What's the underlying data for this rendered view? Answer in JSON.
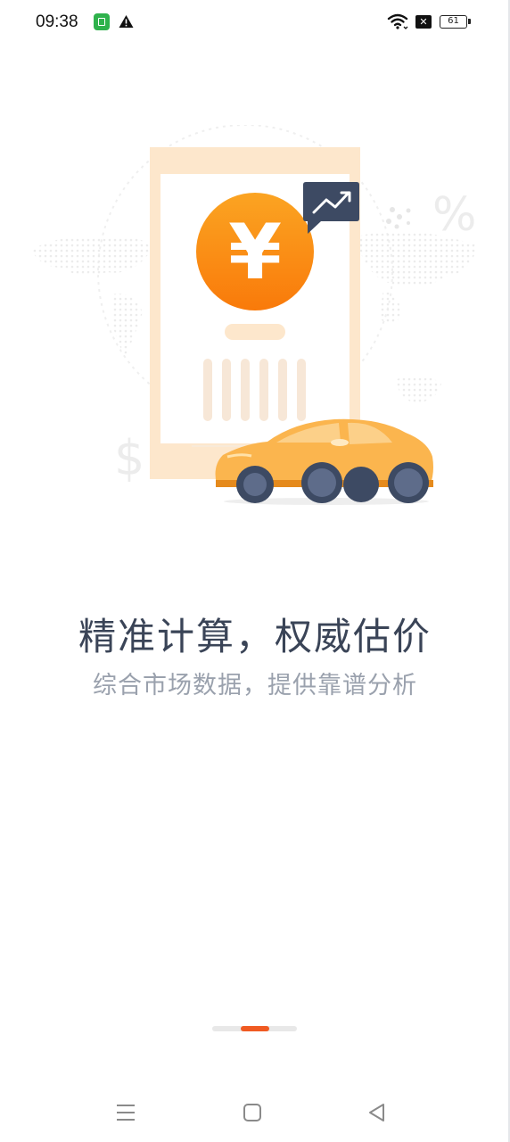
{
  "status_bar": {
    "time": "09:38",
    "battery_level": "61",
    "sim_x_label": "✕",
    "icons": [
      "app-notification-icon",
      "warning-icon",
      "wifi-icon",
      "no-sim-icon",
      "battery-icon"
    ]
  },
  "illustration": {
    "currency_symbol": "¥",
    "percent_symbol": "%",
    "dollar_symbol": "$",
    "icons": [
      "yen-coin-icon",
      "trend-up-icon",
      "car-icon",
      "world-map-icon"
    ]
  },
  "onboarding": {
    "title": "精准计算，权威估价",
    "subtitle": "综合市场数据，提供靠谱分析",
    "page_index": 2,
    "page_count": 3
  },
  "nav_bar": {
    "icons": [
      "menu-icon",
      "home-icon",
      "back-icon"
    ]
  },
  "colors": {
    "accent": "#f05a22",
    "coin": "#fb8c0a",
    "card": "#fde7cc",
    "car_body": "#fbb54e",
    "title": "#3a4457",
    "subtitle": "#9aa1ad"
  }
}
